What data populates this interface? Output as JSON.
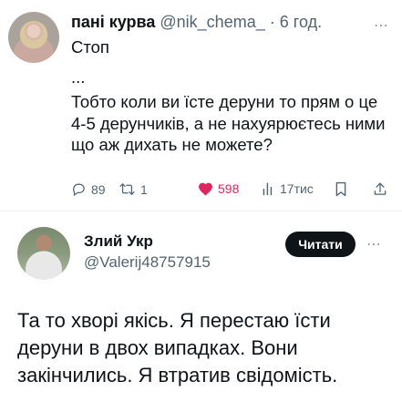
{
  "tweet1": {
    "author_name": "пані курва",
    "handle": "@nik_chema_",
    "separator": "·",
    "time": "6 год.",
    "text_line1": "Стоп",
    "text_ellipsis": "...",
    "text_body": "Тобто коли ви їсте деруни то прям о це 4-5 дерунчиків, а не нахуярюєтесь ними що аж дихать не можете?",
    "more_icon": "⋯",
    "actions": {
      "replies": "89",
      "retweets": "1",
      "likes": "598",
      "views": "17тис"
    },
    "colors": {
      "like": "#e0245e",
      "muted": "#536471"
    }
  },
  "tweet2": {
    "author_name": "Злий Укр",
    "handle": "@Valerij48757915",
    "follow_label": "Читати",
    "more_icon": "⋯",
    "text": "Та то хворі якісь. Я перестаю їсти деруни в двох випадках. Вони закінчились. Я втратив свідомість."
  }
}
